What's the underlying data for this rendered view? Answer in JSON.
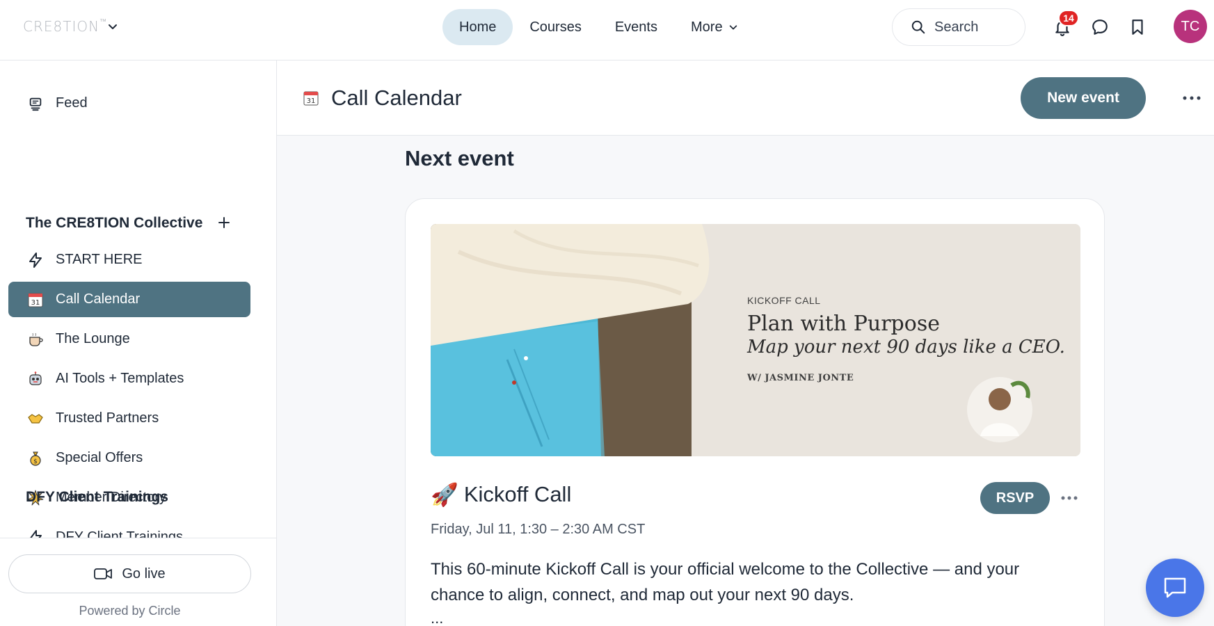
{
  "header": {
    "logo_text": "CRE8TION",
    "logo_mark": "™",
    "nav": [
      {
        "label": "Home",
        "active": true
      },
      {
        "label": "Courses",
        "active": false
      },
      {
        "label": "Events",
        "active": false
      },
      {
        "label": "More",
        "active": false
      }
    ],
    "search_placeholder": "Search",
    "notification_count": "14",
    "avatar_initials": "TC"
  },
  "sidebar": {
    "feed_label": "Feed",
    "group1_title": "The CRE8TION Collective",
    "items": [
      {
        "label": "START HERE",
        "icon": "lightning-icon",
        "active": false
      },
      {
        "label": "Call Calendar",
        "icon": "calendar-icon",
        "active": true
      },
      {
        "label": "The Lounge",
        "icon": "coffee-icon",
        "active": false
      },
      {
        "label": "AI Tools + Templates",
        "icon": "robot-icon",
        "active": false
      },
      {
        "label": "Trusted Partners",
        "icon": "handshake-icon",
        "active": false
      },
      {
        "label": "Special Offers",
        "icon": "money-bag-icon",
        "active": false
      },
      {
        "label": "Member Directory",
        "icon": "sparkle-icon",
        "active": false
      }
    ],
    "group2_title": "DFY Client Trainings",
    "group2_first_item": "DFY Client Trainings",
    "go_live_label": "Go live",
    "powered_by": "Powered by Circle"
  },
  "page": {
    "title": "Call Calendar",
    "new_event_label": "New event",
    "section_title": "Next event"
  },
  "event": {
    "banner_eyebrow": "KICKOFF CALL",
    "banner_title": "Plan with Purpose",
    "banner_subtitle": "Map your next 90 days like a CEO.",
    "banner_with": "W/ JASMINE JONTE",
    "emoji": "🚀",
    "title": "Kickoff Call",
    "rsvp_label": "RSVP",
    "date": "Friday, Jul 11, 1:30 – 2:30 AM CST",
    "description": "This 60-minute Kickoff Call is your official welcome to the Collective — and your chance to align, connect, and map out your next 90 days.",
    "more": "..."
  },
  "colors": {
    "accent": "#4f7382",
    "nav_active_bg": "#dbe9f1",
    "badge": "#e02424",
    "avatar": "#b8327c",
    "chat_fab": "#4a76e8"
  }
}
